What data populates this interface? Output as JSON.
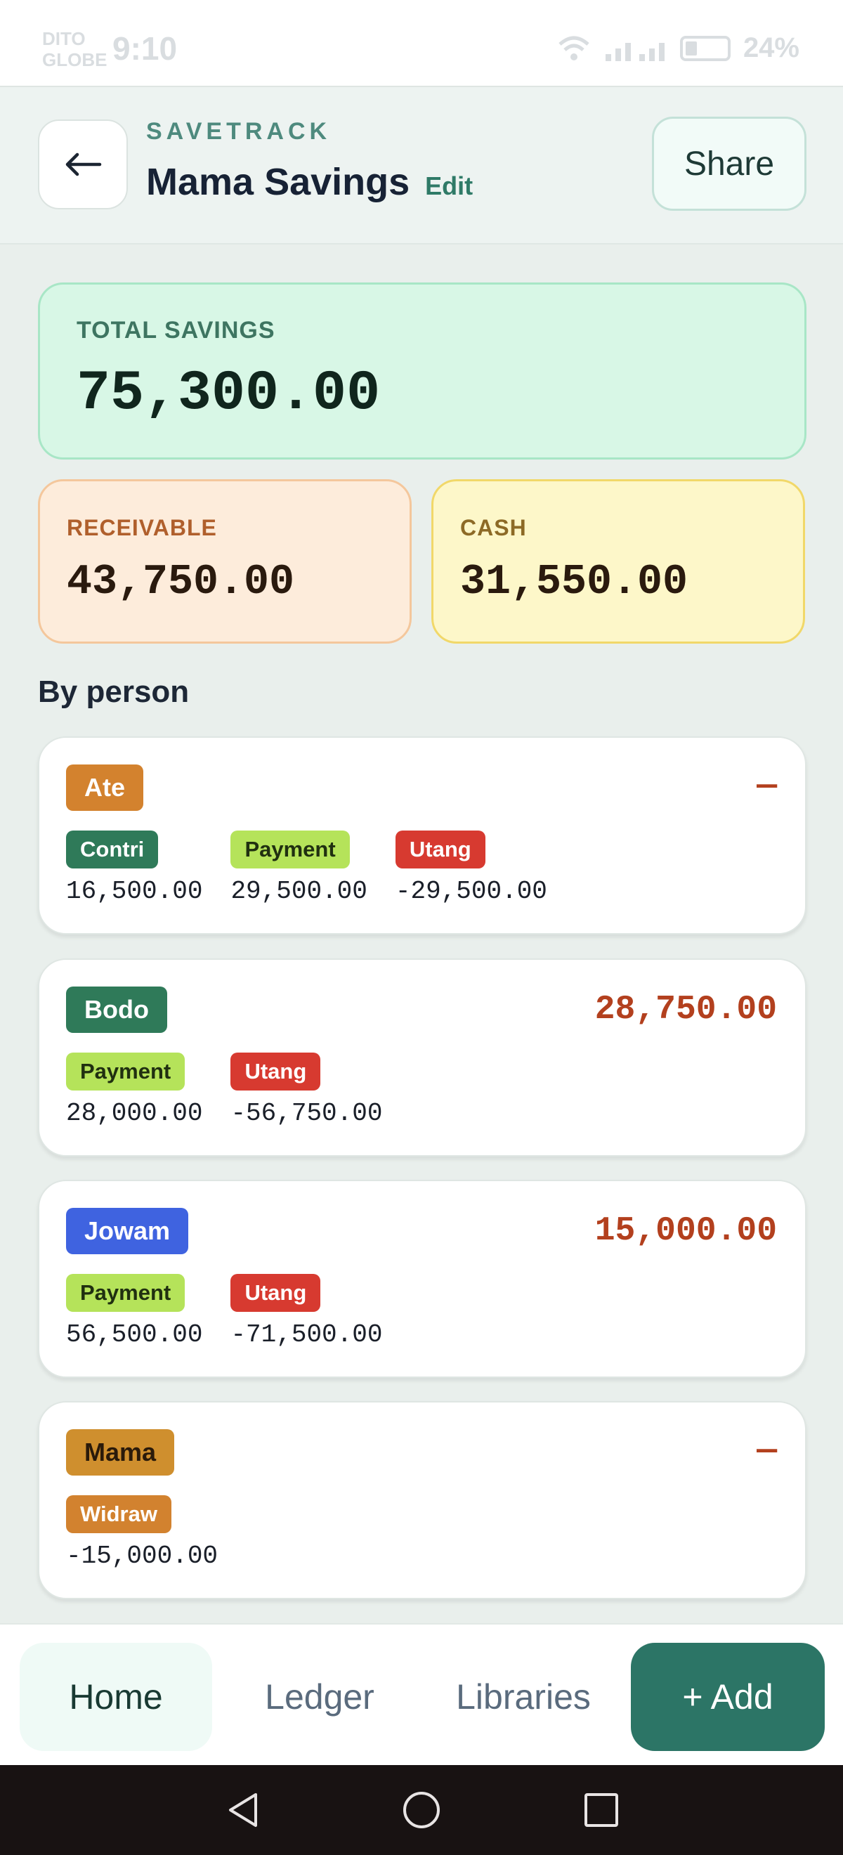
{
  "status_bar": {
    "carrier_line1": "DITO",
    "carrier_line2": "GLOBE",
    "time": "9:10",
    "battery": "24%"
  },
  "header": {
    "brand": "SAVETRACK",
    "title": "Mama Savings",
    "edit_label": "Edit",
    "share_label": "Share",
    "back_icon": "arrow-left-icon"
  },
  "summary": {
    "total_label": "TOTAL SAVINGS",
    "total_value": "75,300.00",
    "receivable_label": "RECEIVABLE",
    "receivable_value": "43,750.00",
    "cash_label": "CASH",
    "cash_value": "31,550.00"
  },
  "section_title": "By person",
  "persons": [
    {
      "name": "Ate",
      "color": "#d3822e",
      "amount": "—",
      "entries": [
        {
          "type": "Contri",
          "value": "16,500.00"
        },
        {
          "type": "Payment",
          "value": "29,500.00"
        },
        {
          "type": "Utang",
          "value": "-29,500.00"
        }
      ]
    },
    {
      "name": "Bodo",
      "color": "#2f7a59",
      "amount": "28,750.00",
      "entries": [
        {
          "type": "Payment",
          "value": "28,000.00"
        },
        {
          "type": "Utang",
          "value": "-56,750.00"
        }
      ]
    },
    {
      "name": "Jowam",
      "color": "#3f63e0",
      "amount": "15,000.00",
      "entries": [
        {
          "type": "Payment",
          "value": "56,500.00"
        },
        {
          "type": "Utang",
          "value": "-71,500.00"
        }
      ]
    },
    {
      "name": "Mama",
      "color": "#cf8f2e",
      "amount": "—",
      "entries": [
        {
          "type": "Widraw",
          "value": "-15,000.00"
        }
      ]
    }
  ],
  "bottom_nav": {
    "home": "Home",
    "ledger": "Ledger",
    "libraries": "Libraries",
    "add": "+ Add"
  },
  "colors": {
    "accent": "#2c7566",
    "negative": "#b3401e",
    "total_bg": "#d8f7e6",
    "receivable_bg": "#fdecdb",
    "cash_bg": "#fdf7c9"
  }
}
